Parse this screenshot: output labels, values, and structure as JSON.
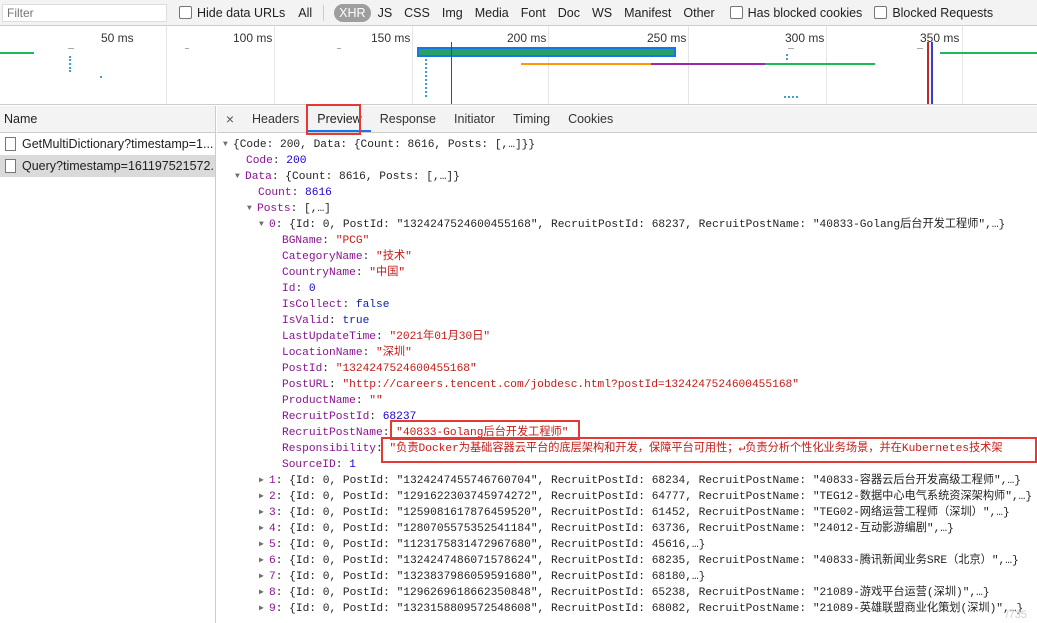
{
  "filterbar": {
    "placeholder": "Filter",
    "hide_data_urls": "Hide data URLs",
    "all": "All",
    "types": [
      "XHR",
      "JS",
      "CSS",
      "Img",
      "Media",
      "Font",
      "Doc",
      "WS",
      "Manifest",
      "Other"
    ],
    "has_blocked_cookies": "Has blocked cookies",
    "blocked_requests": "Blocked Requests"
  },
  "timeline": {
    "ticks": [
      "50 ms",
      "100 ms",
      "150 ms",
      "200 ms",
      "250 ms",
      "300 ms",
      "350 ms"
    ],
    "colors": {
      "waiting": "#00a86b",
      "selected_border": "#1a73e8",
      "receiving": "#1f78d1",
      "orange": "#ff9800",
      "purple": "#9c27b0",
      "marker_red": "#c62828",
      "marker_blue": "#3c3cd0"
    }
  },
  "requests": {
    "header": "Name",
    "items": [
      "GetMultiDictionary?timestamp=1...",
      "Query?timestamp=161197521572..."
    ]
  },
  "detail": {
    "close": "×",
    "tabs": [
      "Headers",
      "Preview",
      "Response",
      "Initiator",
      "Timing",
      "Cookies"
    ],
    "active_tab": "Preview"
  },
  "preview": {
    "root": "{Code: 200, Data: {Count: 8616, Posts: [,…]}}",
    "code_key": "Code",
    "code_val": "200",
    "data_key": "Data",
    "data_summary": "{Count: 8616, Posts: [,…]}",
    "count_key": "Count",
    "count_val": "8616",
    "posts_key": "Posts",
    "posts_summary": "[,…]",
    "item0_key": "0",
    "item0_summary": "{Id: 0, PostId: \"1324247524600455168\", RecruitPostId: 68237, RecruitPostName: \"40833-Golang后台开发工程师\",…}",
    "fields": [
      {
        "k": "BGName",
        "v": "\"PCG\"",
        "t": "s"
      },
      {
        "k": "CategoryName",
        "v": "\"技术\"",
        "t": "s"
      },
      {
        "k": "CountryName",
        "v": "\"中国\"",
        "t": "s"
      },
      {
        "k": "Id",
        "v": "0",
        "t": "n"
      },
      {
        "k": "IsCollect",
        "v": "false",
        "t": "kw"
      },
      {
        "k": "IsValid",
        "v": "true",
        "t": "kw"
      },
      {
        "k": "LastUpdateTime",
        "v": "\"2021年01月30日\"",
        "t": "s"
      },
      {
        "k": "LocationName",
        "v": "\"深圳\"",
        "t": "s"
      },
      {
        "k": "PostId",
        "v": "\"1324247524600455168\"",
        "t": "s"
      },
      {
        "k": "PostURL",
        "v": "\"http://careers.tencent.com/jobdesc.html?postId=1324247524600455168\"",
        "t": "s"
      },
      {
        "k": "ProductName",
        "v": "\"\"",
        "t": "s"
      },
      {
        "k": "RecruitPostId",
        "v": "68237",
        "t": "n"
      },
      {
        "k": "RecruitPostName",
        "v": "\"40833-Golang后台开发工程师\"",
        "t": "s"
      },
      {
        "k": "Responsibility",
        "v": "\"负责Docker为基础容器云平台的底层架构和开发，保障平台可用性；↵负责分析个性化业务场景，并在Kubernetes技术架",
        "t": "s"
      },
      {
        "k": "SourceID",
        "v": "1",
        "t": "n"
      }
    ],
    "items": [
      {
        "k": "1",
        "v": "{Id: 0, PostId: \"1324247455746760704\", RecruitPostId: 68234, RecruitPostName: \"40833-容器云后台开发高级工程师\",…}"
      },
      {
        "k": "2",
        "v": "{Id: 0, PostId: \"1291622303745974272\", RecruitPostId: 64777, RecruitPostName: \"TEG12-数据中心电气系统资深架构师\",…}"
      },
      {
        "k": "3",
        "v": "{Id: 0, PostId: \"1259081617876459520\", RecruitPostId: 61452, RecruitPostName: \"TEG02-网络运营工程师（深圳）\",…}"
      },
      {
        "k": "4",
        "v": "{Id: 0, PostId: \"1280705575352541184\", RecruitPostId: 63736, RecruitPostName: \"24012-互动影游编剧\",…}"
      },
      {
        "k": "5",
        "v": "{Id: 0, PostId: \"1123175831472967680\", RecruitPostId: 45616,…}"
      },
      {
        "k": "6",
        "v": "{Id: 0, PostId: \"1324247486071578624\", RecruitPostId: 68235, RecruitPostName: \"40833-腾讯新闻业务SRE（北京）\",…}"
      },
      {
        "k": "7",
        "v": "{Id: 0, PostId: \"1323837986059591680\", RecruitPostId: 68180,…}"
      },
      {
        "k": "8",
        "v": "{Id: 0, PostId: \"1296269618662350848\", RecruitPostId: 65238, RecruitPostName: \"21089-游戏平台运营(深圳)\",…}"
      },
      {
        "k": "9",
        "v": "{Id: 0, PostId: \"1323158809572548608\", RecruitPostId: 68082, RecruitPostName: \"21089-英雄联盟商业化策划(深圳)\",…}"
      }
    ]
  }
}
